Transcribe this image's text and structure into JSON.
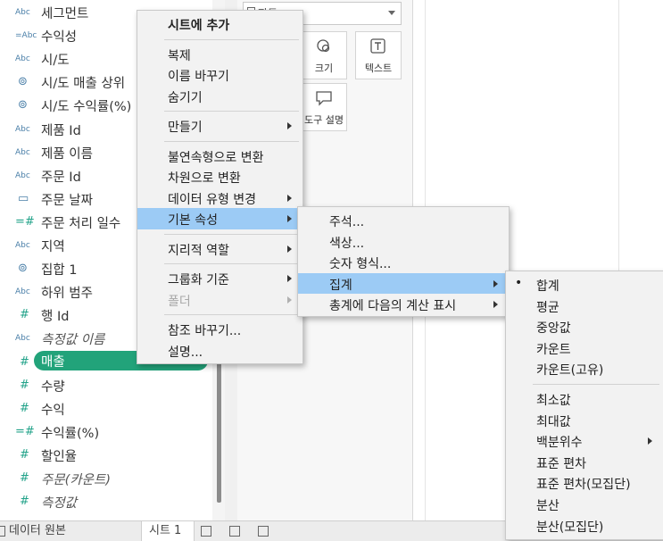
{
  "fields": [
    {
      "icon": "Abc",
      "name": "세그먼트",
      "kind": "dim"
    },
    {
      "icon": "=Abc",
      "name": "수익성",
      "kind": "dim"
    },
    {
      "icon": "Abc",
      "name": "시/도",
      "kind": "dim"
    },
    {
      "icon": "⊚",
      "name": "시/도 매출 상위",
      "kind": "set"
    },
    {
      "icon": "⊚",
      "name": "시/도 수익률(%)",
      "kind": "set"
    },
    {
      "icon": "Abc",
      "name": "제품 Id",
      "kind": "dim"
    },
    {
      "icon": "Abc",
      "name": "제품 이름",
      "kind": "dim"
    },
    {
      "icon": "Abc",
      "name": "주문 Id",
      "kind": "dim"
    },
    {
      "icon": "▭",
      "name": "주문 날짜",
      "kind": "date"
    },
    {
      "icon": "=#",
      "name": "주문 처리 일수",
      "kind": "measure"
    },
    {
      "icon": "Abc",
      "name": "지역",
      "kind": "dim"
    },
    {
      "icon": "⊚",
      "name": "집합 1",
      "kind": "set"
    },
    {
      "icon": "Abc",
      "name": "하위 범주",
      "kind": "dim"
    },
    {
      "icon": "#",
      "name": "행 Id",
      "kind": "measure"
    },
    {
      "icon": "Abc",
      "name": "측정값 이름",
      "kind": "dim",
      "italic": true
    },
    {
      "icon": "#",
      "name": "매출",
      "kind": "measure",
      "selected": true
    },
    {
      "icon": "#",
      "name": "수량",
      "kind": "measure"
    },
    {
      "icon": "#",
      "name": "수익",
      "kind": "measure"
    },
    {
      "icon": "=#",
      "name": "수익률(%)",
      "kind": "measure"
    },
    {
      "icon": "#",
      "name": "할인율",
      "kind": "measure"
    },
    {
      "icon": "#",
      "name": "주문(카운트)",
      "kind": "measure",
      "italic": true
    },
    {
      "icon": "#",
      "name": "측정값",
      "kind": "measure",
      "italic": true
    }
  ],
  "marks": {
    "mark_type": "자동",
    "buttons": [
      {
        "label": "크기",
        "icon": "size-icon"
      },
      {
        "label": "텍스트",
        "icon": "text-icon"
      },
      {
        "label": "도구 설명",
        "icon": "tooltip-icon"
      }
    ]
  },
  "context_menu": {
    "items": [
      {
        "label": "시트에 추가",
        "bold": true
      },
      {
        "sep": true
      },
      {
        "label": "복제"
      },
      {
        "label": "이름 바꾸기"
      },
      {
        "label": "숨기기"
      },
      {
        "sep": true
      },
      {
        "label": "만들기",
        "submenu": true
      },
      {
        "sep": true
      },
      {
        "label": "불연속형으로 변환"
      },
      {
        "label": "차원으로 변환"
      },
      {
        "label": "데이터 유형 변경",
        "submenu": true
      },
      {
        "label": "기본 속성",
        "submenu": true,
        "highlighted": true
      },
      {
        "sep": true
      },
      {
        "label": "지리적 역할",
        "submenu": true
      },
      {
        "sep": true
      },
      {
        "label": "그룹화 기준",
        "submenu": true
      },
      {
        "label": "폴더",
        "submenu": true,
        "disabled": true
      },
      {
        "sep": true
      },
      {
        "label": "참조 바꾸기..."
      },
      {
        "label": "설명..."
      }
    ]
  },
  "default_props_menu": {
    "items": [
      {
        "label": "주석..."
      },
      {
        "label": "색상..."
      },
      {
        "label": "숫자 형식..."
      },
      {
        "label": "집계",
        "submenu": true,
        "highlighted": true
      },
      {
        "label": "총계에 다음의 계산 표시",
        "submenu": true
      }
    ]
  },
  "aggregation_menu": {
    "items": [
      {
        "label": "합계",
        "checked": true
      },
      {
        "label": "평균"
      },
      {
        "label": "중앙값"
      },
      {
        "label": "카운트"
      },
      {
        "label": "카운트(고유)"
      },
      {
        "sep": true
      },
      {
        "label": "최소값"
      },
      {
        "label": "최대값"
      },
      {
        "label": "백분위수",
        "submenu": true
      },
      {
        "label": "표준 편차"
      },
      {
        "label": "표준 편차(모집단)"
      },
      {
        "label": "분산"
      },
      {
        "label": "분산(모집단)"
      }
    ]
  },
  "tabs": {
    "data_source": "데이터 원본",
    "sheet": "시트 1"
  },
  "colors": {
    "selected_pill": "#22a37a",
    "menu_highlight": "#9ccbf5"
  }
}
